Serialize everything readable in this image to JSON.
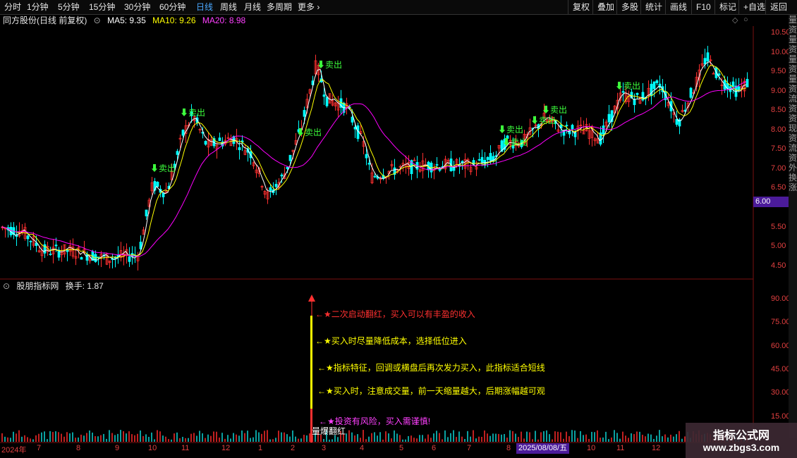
{
  "toolbar": {
    "periods": [
      "分时",
      "1分钟",
      "5分钟",
      "15分钟",
      "30分钟",
      "60分钟",
      "日线",
      "周线",
      "月线",
      "多周期",
      "更多"
    ],
    "active_period": "日线",
    "right_buttons": [
      "复权",
      "叠加",
      "多股",
      "统计",
      "画线",
      "F10",
      "标记",
      "+自选",
      "返回"
    ]
  },
  "main_chart": {
    "title": "同方股份(日线 前复权)",
    "ma5_label": "MA5: 9.35",
    "ma10_label": "MA10: 9.26",
    "ma20_label": "MA20: 8.98",
    "y_ticks": [
      "10.50",
      "10.00",
      "9.50",
      "9.00",
      "8.50",
      "8.00",
      "7.50",
      "7.00",
      "6.50",
      "6.00",
      "5.50",
      "5.00",
      "4.50"
    ],
    "current_price": "6.00",
    "signal_label": "卖出",
    "colors": {
      "ma5": "#ffffff",
      "ma10": "#ffff00",
      "ma20": "#ff00ff",
      "up": "#ff3030",
      "down": "#00ffff",
      "signal": "#3cff3c"
    }
  },
  "indicator_panel": {
    "title": "股朋指标网",
    "turnover_label": "换手: 1.87",
    "y_ticks": [
      "90.00",
      "75.00",
      "60.00",
      "45.00",
      "30.00",
      "15.00"
    ],
    "bar_label": "量爆翻红",
    "notes": [
      {
        "text": "←★二次启动翻红，买入可以有丰盈的收入",
        "color": "#ff3030"
      },
      {
        "text": "←★买入时尽量降低成本，选择低位进入",
        "color": "#ffff00"
      },
      {
        "text": "←★指标特征，回调或横盘后再次发力买入，此指标适合短线",
        "color": "#ffff00"
      },
      {
        "text": "←★买入时，注意成交量，前一天缩量越大，后期涨幅越可观",
        "color": "#ffff00"
      },
      {
        "text": "←★投资有风险，买入需谨慎!",
        "color": "#ff40ff"
      }
    ]
  },
  "x_axis": {
    "year_label": "2024年",
    "months": [
      "7",
      "8",
      "9",
      "10",
      "11",
      "12",
      "1",
      "2",
      "3",
      "4",
      "5",
      "6",
      "7",
      "8",
      "10",
      "11",
      "12"
    ],
    "cursor_date": "2025/08/08/五"
  },
  "sidebar_text": "量资量资量资量资流资资现资流资外换涨",
  "watermark": {
    "title": "指标公式网",
    "url": "www.zbgs3.com"
  }
}
